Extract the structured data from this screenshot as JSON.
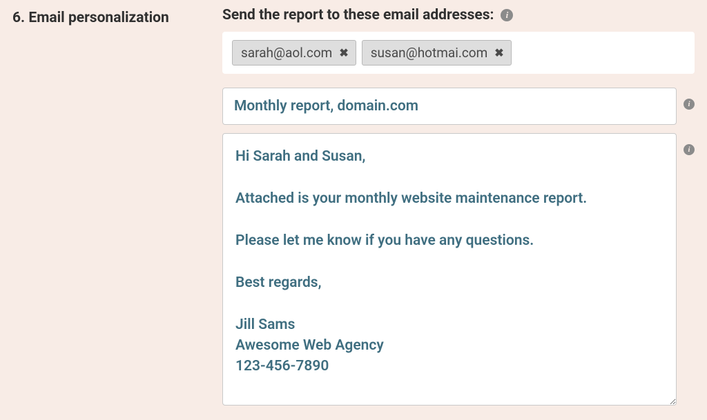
{
  "section": {
    "number": "6.",
    "title": "Email personalization"
  },
  "emails": {
    "label": "Send the report to these email addresses:",
    "tags": [
      "sarah@aol.com",
      "susan@hotmai.com"
    ]
  },
  "subject": {
    "value": "Monthly report, domain.com"
  },
  "body": {
    "value": "Hi Sarah and Susan,\n\nAttached is your monthly website maintenance report.\n\nPlease let me know if you have any questions.\n\nBest regards,\n\nJill Sams\nAwesome Web Agency\n123-456-7890"
  }
}
